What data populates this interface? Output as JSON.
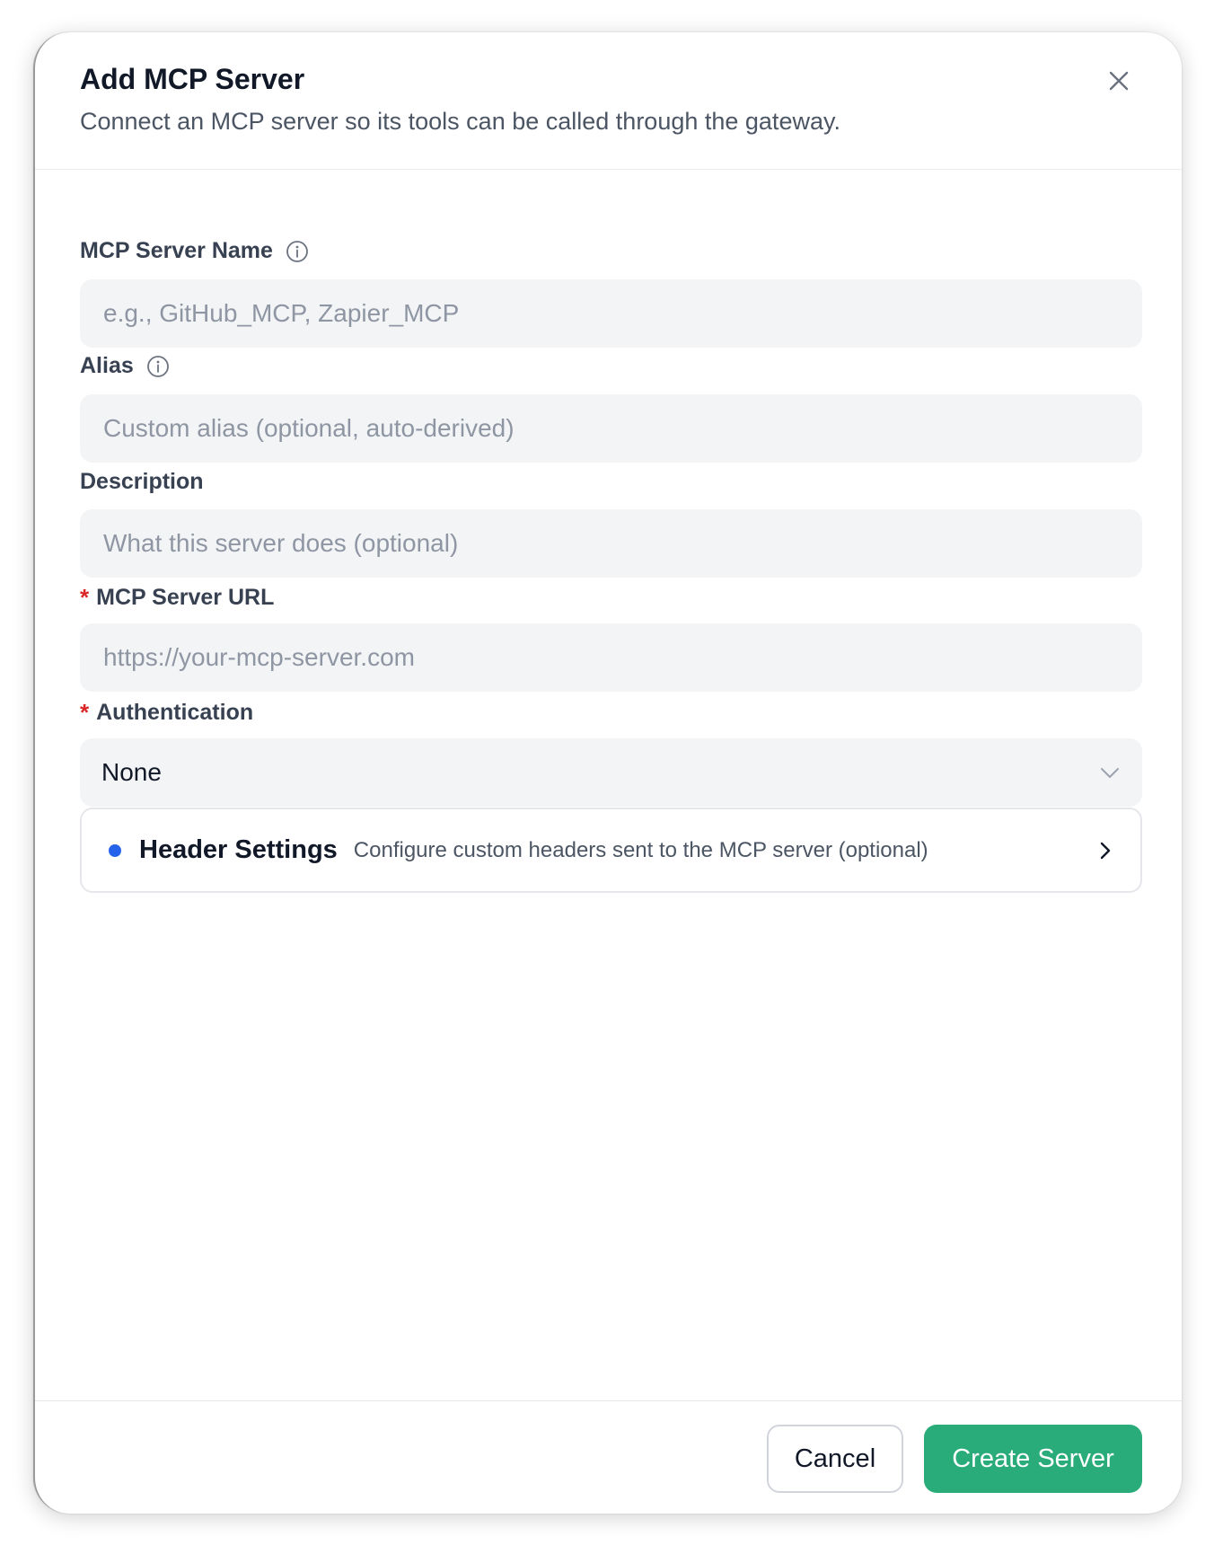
{
  "dialog": {
    "title": "Add MCP Server",
    "subtitle": "Connect an MCP server so its tools can be called through the gateway."
  },
  "form": {
    "server_name": {
      "label": "MCP Server Name",
      "placeholder": "e.g., GitHub_MCP, Zapier_MCP",
      "value": ""
    },
    "alias": {
      "label": "Alias",
      "placeholder": "Custom alias (optional, auto-derived)",
      "value": ""
    },
    "description": {
      "label": "Description",
      "placeholder": "What this server does (optional)",
      "value": ""
    },
    "server_url": {
      "label": "MCP Server URL",
      "required_mark": "*",
      "placeholder": "https://your-mcp-server.com",
      "value": ""
    },
    "authentication": {
      "label": "Authentication",
      "required_mark": "*",
      "selected": "None"
    },
    "header_settings": {
      "title": "Header Settings",
      "description": "Configure custom headers sent to the MCP server (optional)"
    }
  },
  "footer": {
    "cancel_label": "Cancel",
    "create_label": "Create Server"
  },
  "colors": {
    "primary_action": "#2aac7a",
    "required": "#dc2626",
    "indicator_dot": "#2563eb",
    "input_background": "#f3f4f6"
  },
  "icons": {
    "close": "close-icon",
    "info": "info-icon",
    "dropdown": "chevron-down-icon",
    "expand": "chevron-right-icon"
  }
}
